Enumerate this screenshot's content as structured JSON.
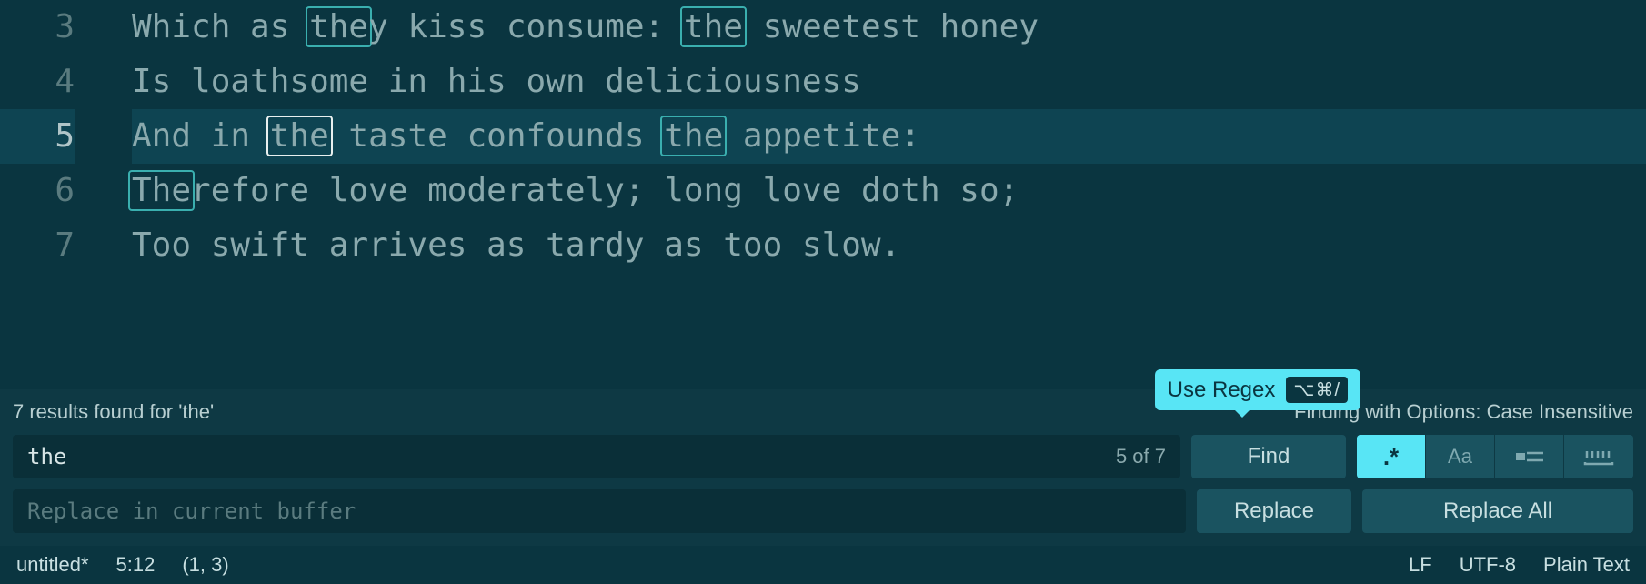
{
  "editor": {
    "lines": [
      {
        "num": "3",
        "active": false,
        "segments": [
          "Which as ",
          {
            "text": "the",
            "hl": true
          },
          "y kiss consume: ",
          {
            "text": "the",
            "hl": true
          },
          " sweetest honey"
        ]
      },
      {
        "num": "4",
        "active": false,
        "segments": [
          "Is loathsome in his own deliciousness"
        ]
      },
      {
        "num": "5",
        "active": true,
        "segments": [
          "And in ",
          {
            "text": "the",
            "hl": true,
            "current": true
          },
          " taste confounds ",
          {
            "text": "the",
            "hl": true
          },
          " appetite:"
        ]
      },
      {
        "num": "6",
        "active": false,
        "segments": [
          {
            "text": "The",
            "hl": true
          },
          "refore love moderately; long love doth so;"
        ]
      },
      {
        "num": "7",
        "active": false,
        "segments": [
          "Too swift arrives as tardy as too slow."
        ]
      }
    ]
  },
  "find": {
    "results_text": "7 results found for 'the'",
    "options_text": "Finding with Options: Case Insensitive",
    "search_value": "the",
    "count_text": "5 of 7",
    "find_label": "Find",
    "replace_placeholder": "Replace in current buffer",
    "replace_label": "Replace",
    "replace_all_label": "Replace All",
    "tooltip_label": "Use Regex",
    "tooltip_kbd": "⌥⌘/",
    "toggles": {
      "regex": ".*",
      "case": "Aa"
    }
  },
  "status": {
    "filename": "untitled*",
    "position": "5:12",
    "selection": "(1, 3)",
    "line_ending": "LF",
    "encoding": "UTF-8",
    "grammar": "Plain Text"
  }
}
